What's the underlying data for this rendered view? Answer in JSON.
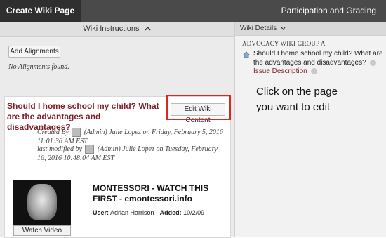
{
  "topbar": {
    "create_tab": "Create Wiki Page",
    "participation_tab": "Participation and Grading"
  },
  "left": {
    "instructions_label": "Wiki Instructions",
    "add_alignments_label": "Add Alignments",
    "no_alignments_text": "No Alignments found.",
    "card": {
      "title": "Should I home school my child? What are the advantages and disadvantages?",
      "edit_button": "Edit Wiki Content",
      "created_line": "Created By",
      "created_text": "(Admin) Julie Lopez on Friday, February 5, 2016 11:01:36 AM EST",
      "modified_line": "last modified by",
      "modified_text": "(Admin) Julie Lopez on Tuesday, February 16, 2016 10:48:04 AM EST",
      "video_title": "MONTESSORI - WATCH THIS FIRST - emontessori.info",
      "video_user_label": "User:",
      "video_user": "Adrian Harrison",
      "video_added_label": "Added:",
      "video_added": "10/2/09",
      "watch_button": "Watch Video"
    }
  },
  "right": {
    "details_label": "Wiki Details",
    "group_name": "ADVOCACY WIKI GROUP A",
    "page_title": "Should I home school my child? What are the advantages and disadvantages?",
    "issue_label": "Issue Description",
    "callout_line1": "Click on the page",
    "callout_line2": "you want to edit"
  },
  "colors": {
    "accent": "#7c1f2a",
    "highlight": "#e2241a",
    "topbar": "#4a4a4a"
  }
}
